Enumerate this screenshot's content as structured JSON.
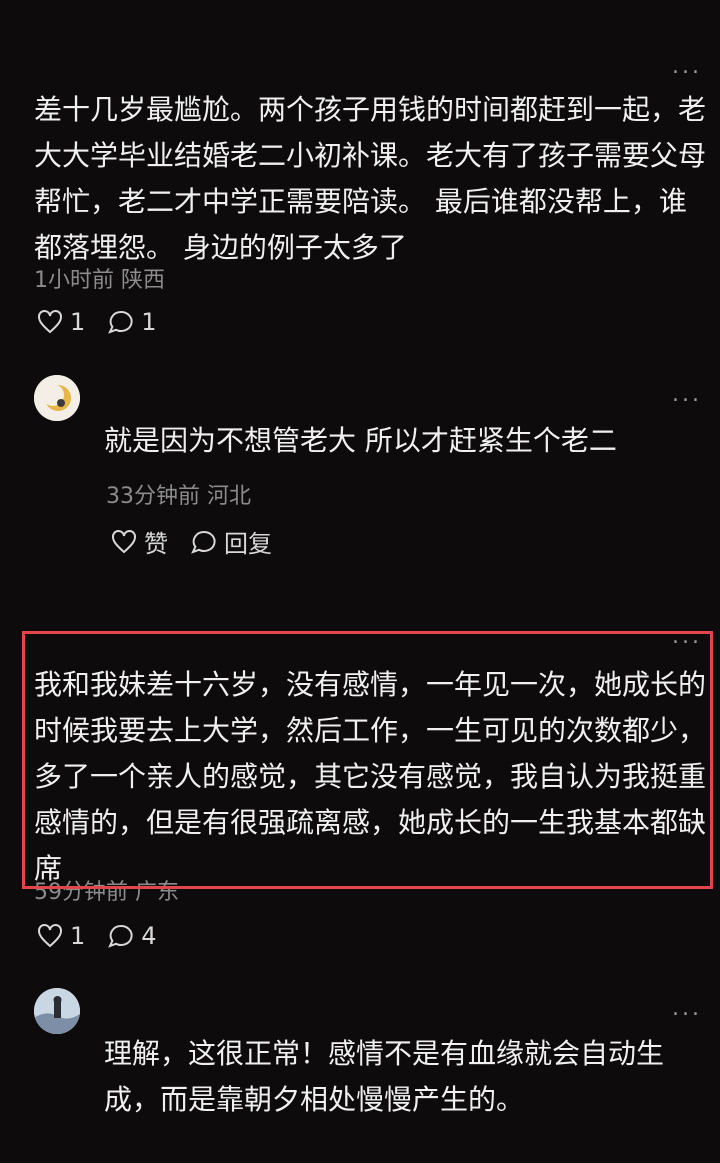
{
  "comments": [
    {
      "text": "差十几岁最尴尬。两个孩子用钱的时间都赶到一起，老大大学毕业结婚老二小初补课。老大有了孩子需要父母帮忙，老二才中学正需要陪读。 最后谁都没帮上，谁都落埋怨。 身边的例子太多了",
      "meta": "1小时前 陕西",
      "likes": "1",
      "replies": "1"
    },
    {
      "text": "就是因为不想管老大 所以才赶紧生个老二",
      "meta": "33分钟前 河北",
      "like_label": "赞",
      "reply_label": "回复"
    },
    {
      "text": "我和我妹差十六岁，没有感情，一年见一次，她成长的时候我要去上大学，然后工作，一生可见的次数都少，多了一个亲人的感觉，其它没有感觉，我自认为我挺重感情的，但是有很强疏离感，她成长的一生我基本都缺席",
      "meta": "59分钟前 广东",
      "likes": "1",
      "replies": "4"
    },
    {
      "text": "理解，这很正常！感情不是有血缘就会自动生成，而是靠朝夕相处慢慢产生的。"
    }
  ],
  "more_glyph": "...",
  "colors": {
    "highlight": "#e0464b",
    "background": "#0d0b0c"
  }
}
